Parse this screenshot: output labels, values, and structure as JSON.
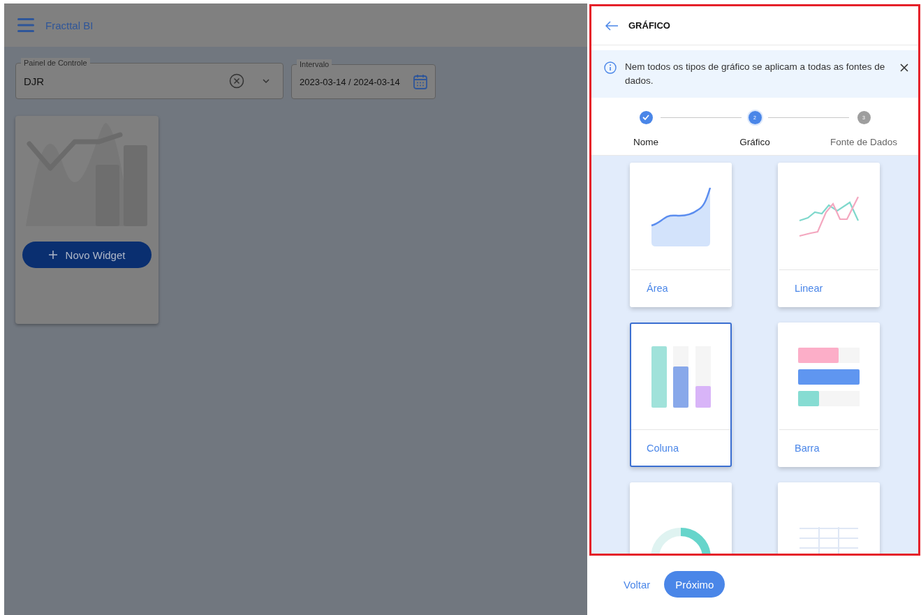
{
  "app": {
    "title": "Fracttal BI"
  },
  "filters": [
    {
      "kind": "select",
      "label": "Painel de Controle",
      "value": "DJR"
    },
    {
      "kind": "date",
      "label": "Intervalo",
      "value": "2023-03-14 / 2024-03-14"
    }
  ],
  "widget_card": {
    "button": "Novo Widget"
  },
  "panel": {
    "title": "GRÁFICO",
    "alert": "Nem todos os tipos de gráfico se aplicam a todas as fontes de dados.",
    "steps": [
      {
        "completed": true,
        "selected": false,
        "label": "Nome"
      },
      {
        "completed": false,
        "selected": true,
        "number": "2",
        "label": "Gráfico"
      },
      {
        "completed": false,
        "selected": false,
        "number": "3",
        "label": "Fonte de Dados"
      }
    ],
    "chart_types": [
      {
        "kind": "area",
        "label": "Área",
        "selected": false
      },
      {
        "kind": "line",
        "label": "Linear",
        "selected": false
      },
      {
        "kind": "column",
        "label": "Coluna",
        "selected": true
      },
      {
        "kind": "bar",
        "label": "Barra",
        "selected": false
      },
      {
        "kind": "donut",
        "selected": false
      },
      {
        "kind": "table",
        "selected": false
      }
    ]
  },
  "footer": {
    "back": "Voltar",
    "next": "Próximo"
  }
}
